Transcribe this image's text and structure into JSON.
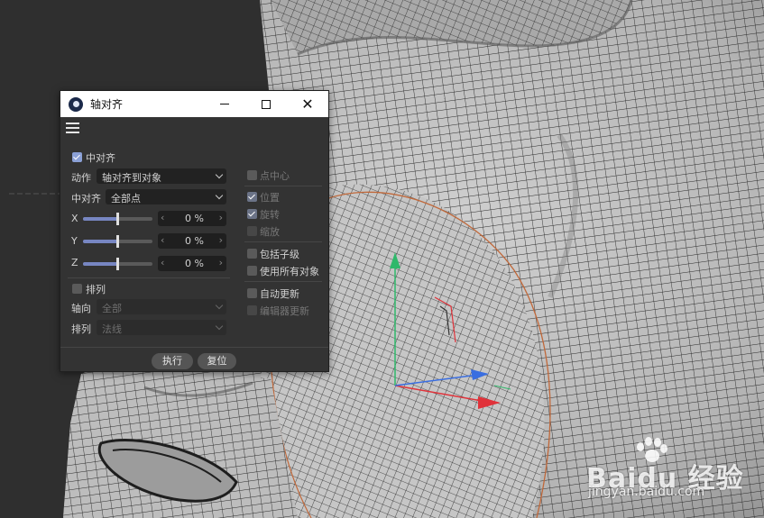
{
  "dialog": {
    "title": "轴对齐",
    "center_align_label": "中对齐",
    "action_label": "动作",
    "action_value": "轴对齐到对象",
    "center_align_mode_label": "中对齐",
    "center_align_mode_value": "全部点",
    "axes": [
      {
        "label": "X",
        "value": "0 %",
        "slider_fraction": 0.5
      },
      {
        "label": "Y",
        "value": "0 %",
        "slider_fraction": 0.5
      },
      {
        "label": "Z",
        "value": "0 %",
        "slider_fraction": 0.5
      }
    ],
    "arrange_label": "排列",
    "direction_label": "轴向",
    "direction_value": "全部",
    "sort_label": "排列",
    "sort_value": "法线",
    "point_center_label": "点中心",
    "position_label": "位置",
    "rotation_label": "旋转",
    "scale_label": "缩放",
    "include_children_label": "包括子级",
    "use_all_objects_label": "使用所有对象",
    "auto_update_label": "自动更新",
    "editor_update_label": "编辑器更新",
    "execute_label": "执行",
    "reset_label": "复位",
    "stepper_left": "‹",
    "stepper_right": "›",
    "close_glyph": "✕"
  },
  "checkboxes": {
    "center_align": true,
    "arrange": false,
    "point_center": false,
    "position": true,
    "rotation": true,
    "scale": false,
    "include_children": false,
    "use_all_objects": false,
    "auto_update": false,
    "editor_update": false
  },
  "watermark": {
    "brand": "Baidu 经验",
    "url": "jingyan.baidu.com"
  },
  "icons": {
    "app": "cinema4d-logo-icon",
    "minimize": "minimize-icon",
    "maximize": "maximize-icon",
    "close": "close-icon",
    "menu": "hamburger-menu-icon",
    "cursor": "mouse-cursor-icon"
  },
  "colors": {
    "viewport_bg": "#2f2f2f",
    "mesh_fill": "#b9b9b9",
    "wire": "#2a2a2a",
    "selection": "#c0683a",
    "axis_y": "#2fb86a",
    "axis_x": "#e0323a",
    "axis_z": "#3a6ee0",
    "accent": "#7786c2"
  }
}
